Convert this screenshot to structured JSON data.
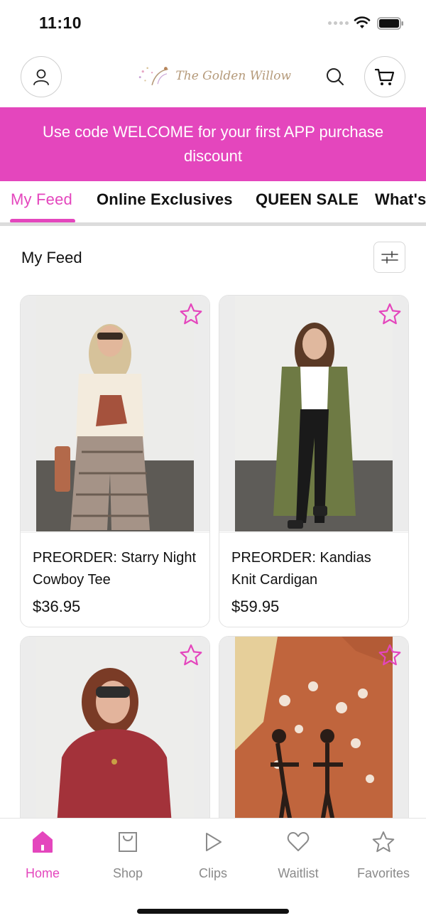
{
  "status_bar": {
    "time": "11:10"
  },
  "header": {
    "logo_text": "The Golden Willow",
    "account_icon": "person-icon",
    "search_icon": "search-icon",
    "cart_icon": "cart-icon"
  },
  "promo": {
    "text": "Use code WELCOME for your first APP purchase discount"
  },
  "tabs": [
    {
      "label": "My Feed",
      "active": true
    },
    {
      "label": "Online Exclusives"
    },
    {
      "label": "QUEEN SALE"
    },
    {
      "label": "What's"
    }
  ],
  "section": {
    "title": "My Feed",
    "filter_icon": "sliders-icon"
  },
  "products": [
    {
      "name": "PREORDER: Starry Night Cowboy Tee",
      "price": "$36.95"
    },
    {
      "name": "PREORDER: Kandias Knit Cardigan",
      "price": "$59.95"
    },
    {
      "name": "",
      "price": ""
    },
    {
      "name": "",
      "price": ""
    }
  ],
  "bottom_nav": [
    {
      "label": "Home",
      "icon": "home-icon",
      "active": true
    },
    {
      "label": "Shop",
      "icon": "shopping-bag-icon"
    },
    {
      "label": "Clips",
      "icon": "play-icon"
    },
    {
      "label": "Waitlist",
      "icon": "heart-icon"
    },
    {
      "label": "Favorites",
      "icon": "star-icon"
    }
  ],
  "colors": {
    "accent": "#e446bd",
    "inactive": "#8a8a8a"
  }
}
